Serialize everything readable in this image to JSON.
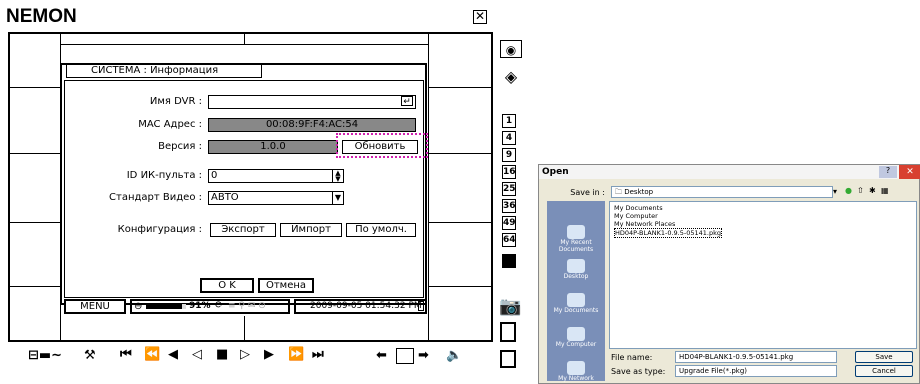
{
  "app": {
    "title": "NEMON",
    "close_label": "✕"
  },
  "dialog": {
    "title": "СИСТЕМА : Информация",
    "fields": {
      "dvr_name_label": "Имя DVR :",
      "dvr_name_value": "",
      "mac_label": "MAC Адрес :",
      "mac_value": "00:08:9F:F4:AC:54",
      "version_label": "Версия :",
      "version_value": "1.0.0",
      "update_button": "Обновить",
      "ir_label": "ID ИК-пульта :",
      "ir_value": "0",
      "video_label": "Стандарт Видео :",
      "video_value": "АВТО",
      "config_label": "Конфигурация :",
      "export_button": "Экспорт",
      "import_button": "Импорт",
      "default_button": "По умолч."
    },
    "ok_button": "O K",
    "cancel_button": "Отмена"
  },
  "statusbar": {
    "menu": "MENU",
    "hdd_percent": "91%",
    "hdd_fill": 0.91,
    "datetime": "2009-09-05 01:54:32 PM"
  },
  "right_buttons": [
    "1",
    "4",
    "9",
    "16",
    "25",
    "36",
    "49",
    "64"
  ],
  "controls": [
    "⏮",
    "⏪",
    "◀",
    "◁",
    "■",
    "▷",
    "▶",
    "⏩",
    "⏭"
  ],
  "open_dialog": {
    "title": "Open",
    "look_in_label": "Save in :",
    "look_in_value": "Desktop",
    "list": [
      "My Documents",
      "My Computer",
      "My Network Places",
      "HD04P-BLANK1-0.9.5-05141.pkg"
    ],
    "sidebar": [
      "My Recent Documents",
      "Desktop",
      "My Documents",
      "My Computer",
      "My Network"
    ],
    "file_name_label": "File name:",
    "file_name_value": "HD04P-BLANK1-0.9.5-05141.pkg",
    "type_label": "Save as type:",
    "type_value": "Upgrade File(*.pkg)",
    "save_button": "Save",
    "cancel_button": "Cancel",
    "close_label": "✕",
    "help_label": "?"
  }
}
